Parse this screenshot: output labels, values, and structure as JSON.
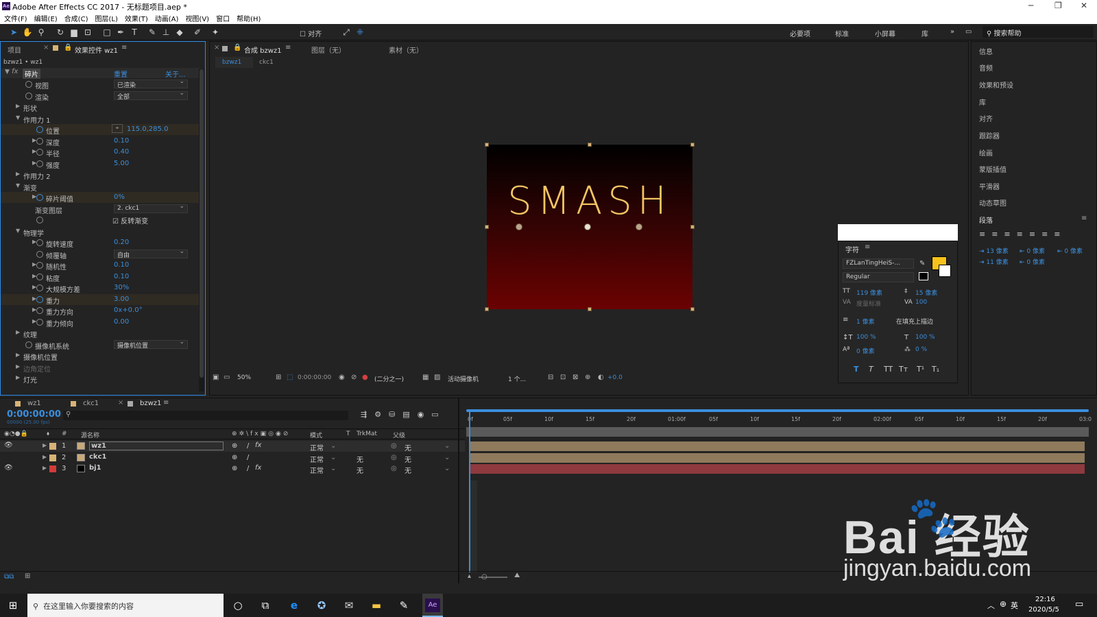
{
  "titlebar": {
    "title": "Adobe After Effects CC 2017 - 无标题项目.aep *",
    "logo": "Ae"
  },
  "menu": [
    "文件(F)",
    "编辑(E)",
    "合成(C)",
    "图层(L)",
    "效果(T)",
    "动画(A)",
    "视图(V)",
    "窗口",
    "帮助(H)"
  ],
  "toolbar": {
    "align_label": "对齐",
    "workspaces": [
      "必要项",
      "标准",
      "小屏幕",
      "库"
    ],
    "search_help": "搜索帮助"
  },
  "left_panel": {
    "tab_project": "项目",
    "tab_effects": "效果控件 wz1",
    "breadcrumb": "bzwz1 • wz1",
    "effect_name": "碎片",
    "reset": "重置",
    "about": "关于...",
    "rows": [
      {
        "indent": 3,
        "label": "视图",
        "type": "dd",
        "value": "已渲染"
      },
      {
        "indent": 3,
        "label": "渲染",
        "type": "dd",
        "value": "全部"
      },
      {
        "indent": 1,
        "label": "形状",
        "tri": "▶"
      },
      {
        "indent": 1,
        "label": "作用力 1",
        "tri": "▼"
      },
      {
        "indent": 4,
        "label": "位置",
        "type": "val",
        "value": "115.0,285.0",
        "hl": true,
        "anim": true
      },
      {
        "indent": 4,
        "label": "深度",
        "type": "val",
        "value": "0.10",
        "tri": "▶"
      },
      {
        "indent": 4,
        "label": "半径",
        "type": "val",
        "value": "0.40",
        "tri": "▶"
      },
      {
        "indent": 4,
        "label": "强度",
        "type": "val",
        "value": "5.00",
        "tri": "▶"
      },
      {
        "indent": 1,
        "label": "作用力 2",
        "tri": "▶"
      },
      {
        "indent": 1,
        "label": "渐变",
        "tri": "▼"
      },
      {
        "indent": 4,
        "label": "碎片阈值",
        "type": "val",
        "value": "0%",
        "tri": "▶",
        "hl": true,
        "anim": true
      },
      {
        "indent": 3,
        "label": "渐变图层",
        "type": "dd",
        "value": "2. ckc1",
        "nosw": true
      },
      {
        "indent": 4,
        "label": "",
        "type": "check",
        "value": "反转渐变"
      },
      {
        "indent": 1,
        "label": "物理学",
        "tri": "▼"
      },
      {
        "indent": 4,
        "label": "旋转速度",
        "type": "val",
        "value": "0.20",
        "tri": "▶"
      },
      {
        "indent": 4,
        "label": "倾覆轴",
        "type": "dd",
        "value": "自由"
      },
      {
        "indent": 4,
        "label": "随机性",
        "type": "val",
        "value": "0.10",
        "tri": "▶"
      },
      {
        "indent": 4,
        "label": "粘度",
        "type": "val",
        "value": "0.10",
        "tri": "▶"
      },
      {
        "indent": 4,
        "label": "大规模方差",
        "type": "val",
        "value": "30%",
        "tri": "▶"
      },
      {
        "indent": 4,
        "label": "重力",
        "type": "val",
        "value": "3.00",
        "tri": "▶",
        "hl": true,
        "anim": true
      },
      {
        "indent": 4,
        "label": "重力方向",
        "type": "val",
        "value": "0x+0.0°",
        "tri": "▶"
      },
      {
        "indent": 4,
        "label": "重力倾向",
        "type": "val",
        "value": "0.00",
        "tri": "▶"
      },
      {
        "indent": 1,
        "label": "纹理",
        "tri": "▶"
      },
      {
        "indent": 3,
        "label": "摄像机系统",
        "type": "dd",
        "value": "摄像机位置"
      },
      {
        "indent": 1,
        "label": "摄像机位置",
        "tri": "▶"
      },
      {
        "indent": 1,
        "label": "边角定位",
        "tri": "▶",
        "dim": true
      },
      {
        "indent": 1,
        "label": "灯光",
        "tri": "▶"
      }
    ]
  },
  "comp_panel": {
    "tab_comp": "合成 bzwz1",
    "tab_layer": "图层（无）",
    "tab_footage": "素材（无）",
    "sub_tabs": [
      "bzwz1",
      "ckc1"
    ],
    "canvas_text": "SMASH",
    "zoom": "50%",
    "timecode": "0:00:00:00",
    "resolution": "(二分之一)",
    "camera": "活动摄像机",
    "views": "1 个...",
    "exposure": "+0.0"
  },
  "right_panel": {
    "items": [
      "信息",
      "音频",
      "效果和预设",
      "库",
      "对齐",
      "跟踪器",
      "绘画",
      "蒙版插值",
      "平滑器",
      "动态草图"
    ],
    "paragraph_title": "段落",
    "para_values": [
      "13 像素",
      "0 像素",
      "0 像素",
      "11 像素",
      "0 像素"
    ]
  },
  "character_panel": {
    "title": "字符",
    "font": "FZLanTingHeiS-...",
    "style": "Regular",
    "size": "119 像素",
    "leading": "15 像素",
    "kerning": "度量标准",
    "tracking": "100",
    "stroke": "1 像素",
    "stroke_mode": "在填充上描边",
    "vscale": "100 %",
    "hscale": "100 %",
    "baseline": "0 像素",
    "tsume": "0 %",
    "fill_color": "#f8c21a",
    "styles": [
      "T",
      "T",
      "TT",
      "Tт",
      "T¹",
      "T₁"
    ]
  },
  "timeline": {
    "tabs": [
      "wz1",
      "ckc1",
      "bzwz1"
    ],
    "timecode": "0:00:00:00",
    "fps": "00000 (25.00 fps)",
    "columns": [
      "#",
      "源名称",
      "模式",
      "T",
      "TrkMat",
      "父级"
    ],
    "ruler": [
      "0f",
      "05f",
      "10f",
      "15f",
      "20f",
      "01:00f",
      "05f",
      "10f",
      "15f",
      "20f",
      "02:00f",
      "05f",
      "10f",
      "15f",
      "20f",
      "03:0"
    ],
    "layers": [
      {
        "num": "1",
        "name": "wz1",
        "mode": "正常",
        "trkmat": "",
        "parent": "无",
        "color": "#c8a97a",
        "bar": "#8f7a5c",
        "label": "#d7b377",
        "fx": true
      },
      {
        "num": "2",
        "name": "ckc1",
        "mode": "正常",
        "trkmat": "无",
        "parent": "无",
        "color": "#c8a97a",
        "bar": "#8f7a5c",
        "label": "#d7b377",
        "fx": false
      },
      {
        "num": "3",
        "name": "bj1",
        "mode": "正常",
        "trkmat": "无",
        "parent": "无",
        "color": "#000000",
        "bar": "#8e3a3e",
        "label": "#d23a3a",
        "fx": true
      }
    ]
  },
  "taskbar": {
    "search": "在这里输入你要搜索的内容",
    "time": "22:16",
    "date": "2020/5/5",
    "ime": "英"
  },
  "watermark": {
    "brand": "Bai  经验",
    "url": "jingyan.baidu.com"
  }
}
